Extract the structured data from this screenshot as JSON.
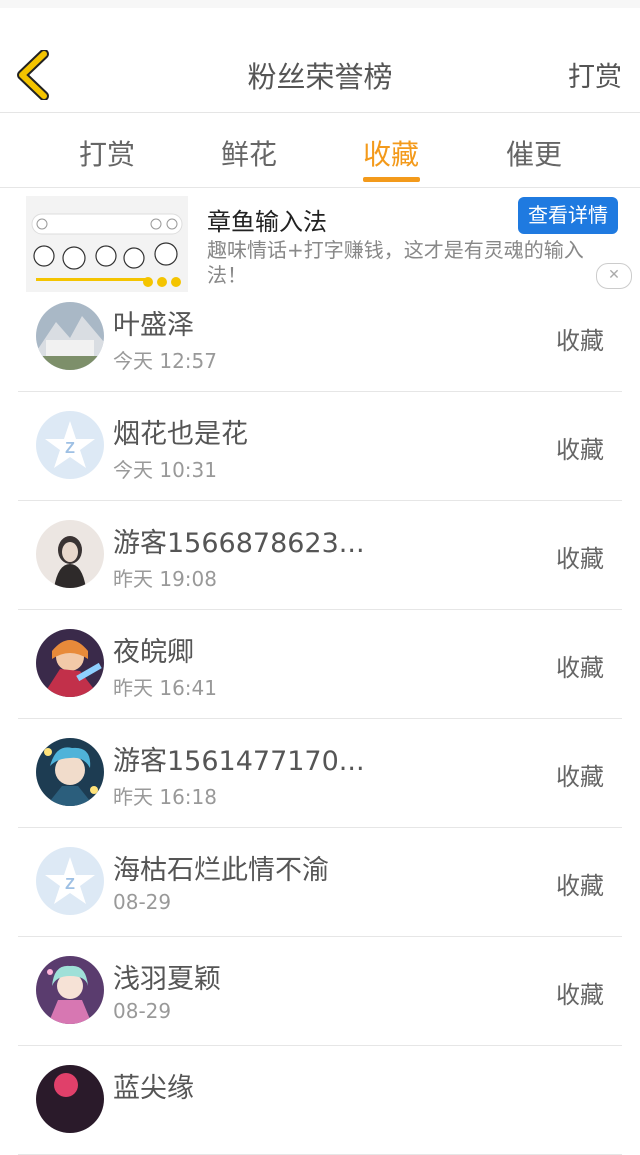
{
  "header": {
    "title": "粉丝荣誉榜",
    "right_action": "打赏"
  },
  "tabs": [
    {
      "label": "打赏",
      "active": false
    },
    {
      "label": "鲜花",
      "active": false
    },
    {
      "label": "收藏",
      "active": true
    },
    {
      "label": "催更",
      "active": false
    }
  ],
  "ad": {
    "title": "章鱼输入法",
    "description": "趣味情话+打字赚钱，这才是有灵魂的输入法！",
    "button": "查看详情",
    "close_icon": "close-icon"
  },
  "colors": {
    "accent": "#f39a1b",
    "ad_button": "#1f7ae0",
    "back_arrow": "#f4c400"
  },
  "list": [
    {
      "name": "叶盛泽",
      "time": "今天 12:57",
      "action": "收藏",
      "avatar": "photo"
    },
    {
      "name": "烟花也是花",
      "time": "今天 10:31",
      "action": "收藏",
      "avatar": "default"
    },
    {
      "name": "游客1566878623...",
      "time": "昨天 19:08",
      "action": "收藏",
      "avatar": "photo"
    },
    {
      "name": "夜皖卿",
      "time": "昨天 16:41",
      "action": "收藏",
      "avatar": "anime"
    },
    {
      "name": "游客1561477170...",
      "time": "昨天 16:18",
      "action": "收藏",
      "avatar": "anime"
    },
    {
      "name": "海枯石烂此情不渝",
      "time": "08-29",
      "action": "收藏",
      "avatar": "default"
    },
    {
      "name": "浅羽夏颖",
      "time": "08-29",
      "action": "收藏",
      "avatar": "anime"
    },
    {
      "name": "蓝尖缘",
      "time": "",
      "action": "",
      "avatar": "anime"
    }
  ]
}
